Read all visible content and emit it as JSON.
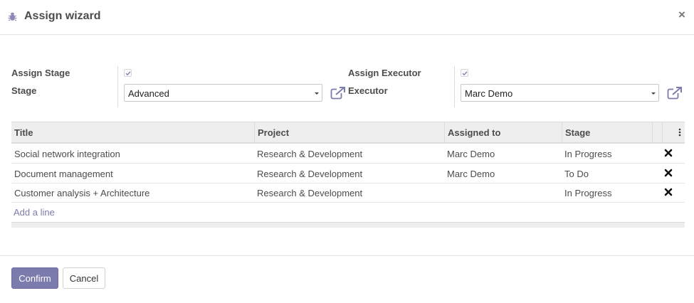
{
  "dialog": {
    "title": "Assign wizard",
    "close_glyph": "×",
    "accent_color": "#7c7bad"
  },
  "form": {
    "assign_stage_label": "Assign Stage",
    "assign_stage_checked": true,
    "stage_label": "Stage",
    "stage_value": "Advanced",
    "assign_executor_label": "Assign Executor",
    "assign_executor_checked": true,
    "executor_label": "Executor",
    "executor_value": "Marc Demo"
  },
  "table": {
    "columns": [
      "Title",
      "Project",
      "Assigned to",
      "Stage"
    ],
    "rows": [
      {
        "title": "Social network integration",
        "project": "Research & Development",
        "assigned_to": "Marc Demo",
        "stage": "In Progress"
      },
      {
        "title": "Document management",
        "project": "Research & Development",
        "assigned_to": "Marc Demo",
        "stage": "To Do"
      },
      {
        "title": "Customer analysis + Architecture",
        "project": "Research & Development",
        "assigned_to": "",
        "stage": "In Progress"
      }
    ],
    "add_line_label": "Add a line"
  },
  "footer": {
    "confirm_label": "Confirm",
    "cancel_label": "Cancel"
  },
  "icons": {
    "header": "bug-icon",
    "close": "close-icon",
    "external": "external-link-icon",
    "row_delete": "delete-icon",
    "column_options": "kebab-menu-icon",
    "checkbox": "check-icon",
    "dropdown": "caret-down-icon"
  }
}
